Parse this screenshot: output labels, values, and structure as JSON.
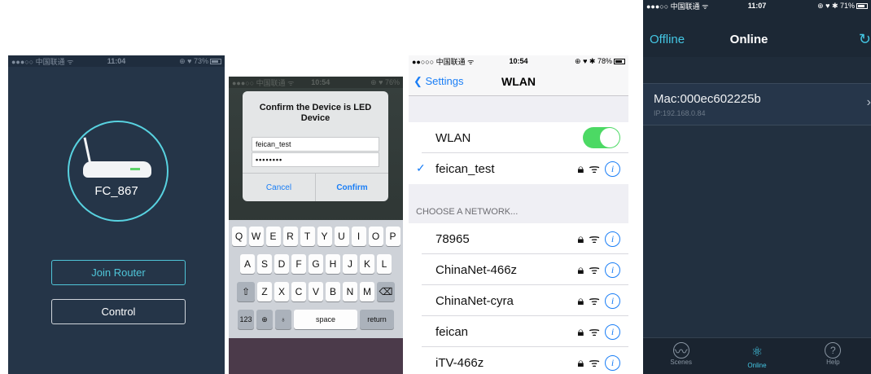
{
  "screen1": {
    "status": {
      "left": "●●●○○ 中国联通 ᯤ",
      "time": "11:04",
      "right": "⊕ ♥ 73%"
    },
    "device_name": "FC_867",
    "join_label": "Join Router",
    "control_label": "Control",
    "colors": {
      "bg": "#253548",
      "accent": "#4fc5d8"
    }
  },
  "screen2": {
    "status": {
      "left": "●●●○○ 中国联通 ᯤ",
      "time": "10:54",
      "right": "⊕ ♥ 76%"
    },
    "dialog_title": "Confirm the Device is LED Device",
    "ssid_value": "feican_test",
    "password_value": "••••••••",
    "cancel_label": "Cancel",
    "confirm_label": "Confirm",
    "keyboard": {
      "row1": [
        "Q",
        "W",
        "E",
        "R",
        "T",
        "Y",
        "U",
        "I",
        "O",
        "P"
      ],
      "row2": [
        "A",
        "S",
        "D",
        "F",
        "G",
        "H",
        "J",
        "K",
        "L"
      ],
      "row3": [
        "Z",
        "X",
        "C",
        "V",
        "B",
        "N",
        "M"
      ],
      "shift_icon": "shift-icon",
      "delete_icon": "delete-icon",
      "numbers_label": "123",
      "globe_icon": "globe-icon",
      "mic_icon": "microphone-icon",
      "space_label": "space",
      "return_label": "return"
    }
  },
  "screen3": {
    "status": {
      "left": "●●○○○ 中国联通 ᯤ",
      "time": "10:54",
      "right": "⊕ ♥ ✱ 78%"
    },
    "back_label": "Settings",
    "title": "WLAN",
    "wlan_label": "WLAN",
    "wlan_on": true,
    "connected_network": "feican_test",
    "section_header": "CHOOSE A NETWORK...",
    "networks": [
      "78965",
      "ChinaNet-466z",
      "ChinaNet-cyra",
      "feican",
      "iTV-466z"
    ],
    "colors": {
      "tint": "#1a7ef6",
      "toggle_on": "#4cd964"
    }
  },
  "screen4": {
    "status": {
      "left": "●●●○○ 中国联通 ᯤ",
      "time": "11:07",
      "right": "⊕ ♥ ✱ 71%"
    },
    "offline_label": "Offline",
    "title": "Online",
    "device": {
      "mac": "Mac:000ec602225b",
      "ip": "IP:192.168.0.84"
    },
    "tabs": [
      {
        "label": "Scenes",
        "icon": "scenes-icon"
      },
      {
        "label": "Online",
        "icon": "atom-icon"
      },
      {
        "label": "Help",
        "icon": "help-icon"
      }
    ],
    "active_tab": "Online",
    "colors": {
      "accent": "#44c7e4",
      "bg": "#223040"
    }
  }
}
